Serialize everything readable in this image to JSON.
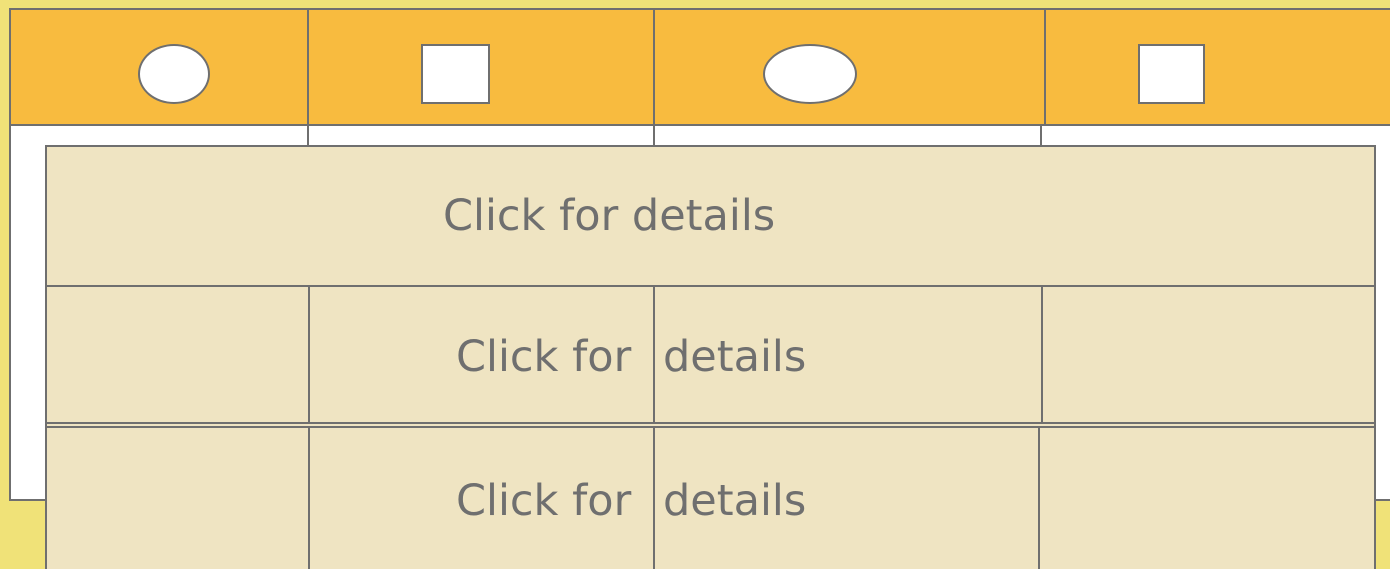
{
  "header": {
    "shapes": [
      {
        "kind": "ellipse",
        "icon": "circle-icon"
      },
      {
        "kind": "square",
        "icon": "square-icon"
      },
      {
        "kind": "ellipse",
        "icon": "ellipse-icon"
      },
      {
        "kind": "square",
        "icon": "square-icon"
      }
    ]
  },
  "rows": [
    {
      "label": "Click for details"
    },
    {
      "label_left": "Click for",
      "label_right": "details"
    },
    {
      "label_left": "Click for",
      "label_right": "details"
    }
  ],
  "colors": {
    "background": "#f0e278",
    "header": "#f8bb3f",
    "panel": "#efe4c2",
    "board": "#ffffff",
    "stroke": "#6f6f6f"
  }
}
